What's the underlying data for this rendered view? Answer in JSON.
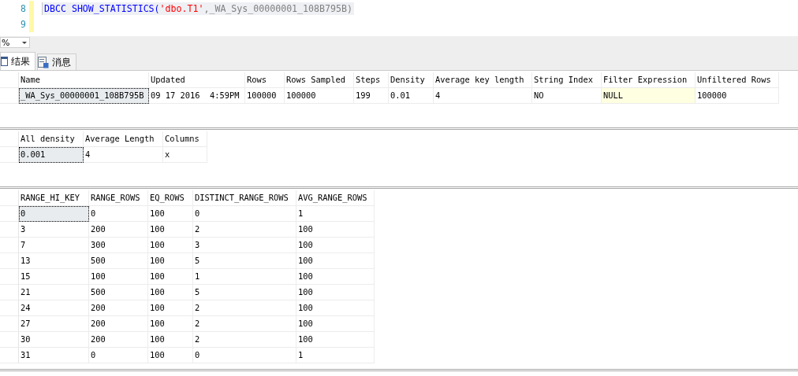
{
  "editor": {
    "lines": [
      {
        "number": "8",
        "tokens": [
          {
            "kind": "keyword",
            "text": "DBCC SHOW_STATISTICS("
          },
          {
            "kind": "string",
            "text": "'dbo.T1'"
          },
          {
            "kind": "plain",
            "text": ",_WA_Sys_00000001_108B795B)"
          }
        ]
      },
      {
        "number": "9"
      }
    ]
  },
  "zoom": {
    "value": "%"
  },
  "tabs": [
    {
      "label": "结果",
      "selected": true
    },
    {
      "label": "消息",
      "selected": false
    }
  ],
  "grids": [
    {
      "columns": [
        "Name",
        "Updated",
        "Rows",
        "Rows Sampled",
        "Steps",
        "Density",
        "Average key length",
        "String Index",
        "Filter Expression",
        "Unfiltered Rows"
      ],
      "rows": [
        [
          {
            "text": "_WA_Sys_00000001_108B795B",
            "selected": true,
            "null": false
          },
          {
            "text": "09 17 2016  4:59PM",
            "selected": false,
            "null": false
          },
          {
            "text": "100000",
            "selected": false,
            "null": false
          },
          {
            "text": "100000",
            "selected": false,
            "null": false
          },
          {
            "text": "199",
            "selected": false,
            "null": false
          },
          {
            "text": "0.01",
            "selected": false,
            "null": false
          },
          {
            "text": "4",
            "selected": false,
            "null": false
          },
          {
            "text": "NO",
            "selected": false,
            "null": false
          },
          {
            "text": "NULL",
            "selected": false,
            "null": true
          },
          {
            "text": "100000",
            "selected": false,
            "null": false
          }
        ]
      ]
    },
    {
      "columns": [
        "All density",
        "Average Length",
        "Columns"
      ],
      "rows": [
        [
          {
            "text": "0.001",
            "selected": true
          },
          {
            "text": "4",
            "selected": false
          },
          {
            "text": "x",
            "selected": false
          }
        ]
      ]
    },
    {
      "columns": [
        "RANGE_HI_KEY",
        "RANGE_ROWS",
        "EQ_ROWS",
        "DISTINCT_RANGE_ROWS",
        "AVG_RANGE_ROWS"
      ],
      "rows": [
        [
          {
            "text": "0",
            "selected": true
          },
          {
            "text": "0",
            "selected": false
          },
          {
            "text": "100",
            "selected": false
          },
          {
            "text": "0",
            "selected": false
          },
          {
            "text": "1",
            "selected": false
          }
        ],
        [
          {
            "text": "3",
            "selected": false
          },
          {
            "text": "200",
            "selected": false
          },
          {
            "text": "100",
            "selected": false
          },
          {
            "text": "2",
            "selected": false
          },
          {
            "text": "100",
            "selected": false
          }
        ],
        [
          {
            "text": "7",
            "selected": false
          },
          {
            "text": "300",
            "selected": false
          },
          {
            "text": "100",
            "selected": false
          },
          {
            "text": "3",
            "selected": false
          },
          {
            "text": "100",
            "selected": false
          }
        ],
        [
          {
            "text": "13",
            "selected": false
          },
          {
            "text": "500",
            "selected": false
          },
          {
            "text": "100",
            "selected": false
          },
          {
            "text": "5",
            "selected": false
          },
          {
            "text": "100",
            "selected": false
          }
        ],
        [
          {
            "text": "15",
            "selected": false
          },
          {
            "text": "100",
            "selected": false
          },
          {
            "text": "100",
            "selected": false
          },
          {
            "text": "1",
            "selected": false
          },
          {
            "text": "100",
            "selected": false
          }
        ],
        [
          {
            "text": "21",
            "selected": false
          },
          {
            "text": "500",
            "selected": false
          },
          {
            "text": "100",
            "selected": false
          },
          {
            "text": "5",
            "selected": false
          },
          {
            "text": "100",
            "selected": false
          }
        ],
        [
          {
            "text": "24",
            "selected": false
          },
          {
            "text": "200",
            "selected": false
          },
          {
            "text": "100",
            "selected": false
          },
          {
            "text": "2",
            "selected": false
          },
          {
            "text": "100",
            "selected": false
          }
        ],
        [
          {
            "text": "27",
            "selected": false
          },
          {
            "text": "200",
            "selected": false
          },
          {
            "text": "100",
            "selected": false
          },
          {
            "text": "2",
            "selected": false
          },
          {
            "text": "100",
            "selected": false
          }
        ],
        [
          {
            "text": "30",
            "selected": false
          },
          {
            "text": "200",
            "selected": false
          },
          {
            "text": "100",
            "selected": false
          },
          {
            "text": "2",
            "selected": false
          },
          {
            "text": "100",
            "selected": false
          }
        ],
        [
          {
            "text": "31",
            "selected": false
          },
          {
            "text": "0",
            "selected": false
          },
          {
            "text": "100",
            "selected": false
          },
          {
            "text": "0",
            "selected": false
          },
          {
            "text": "1",
            "selected": false
          }
        ]
      ]
    }
  ]
}
